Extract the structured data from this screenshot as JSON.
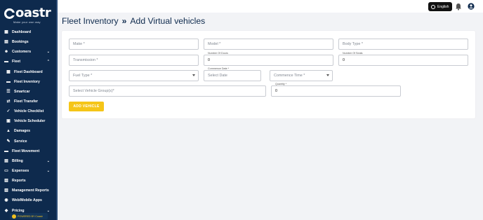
{
  "app": {
    "logo_text": "oastr",
    "logo_tagline": "Make your own way",
    "powered_by": "POWERED BY Coastr"
  },
  "topbar": {
    "language_label": "English",
    "icons": [
      "globe-icon",
      "bell-icon",
      "user-account-icon"
    ]
  },
  "sidebar": {
    "items": [
      {
        "label": "Dashboard",
        "icon": "dashboard-icon",
        "has_chevron": false,
        "sub": false
      },
      {
        "label": "Bookings",
        "icon": "calendar-icon",
        "has_chevron": false,
        "sub": false
      },
      {
        "label": "Customers",
        "icon": "users-icon",
        "has_chevron": true,
        "chevron": "down",
        "sub": false
      },
      {
        "label": "Fleet",
        "icon": "car-icon",
        "has_chevron": true,
        "chevron": "up",
        "sub": false
      },
      {
        "label": "Fleet Dashboard",
        "icon": "grid-icon",
        "has_chevron": false,
        "sub": true
      },
      {
        "label": "Fleet Inventory",
        "icon": "car-icon",
        "has_chevron": false,
        "sub": true
      },
      {
        "label": "Smartcar",
        "icon": "list-icon",
        "has_chevron": false,
        "sub": true
      },
      {
        "label": "Fleet Transfer",
        "icon": "transfer-icon",
        "has_chevron": false,
        "sub": true
      },
      {
        "label": "Vehicle Checklist",
        "icon": "checklist-icon",
        "has_chevron": false,
        "sub": true
      },
      {
        "label": "Vehicle Scheduler",
        "icon": "scheduler-icon",
        "has_chevron": false,
        "sub": true
      },
      {
        "label": "Damages",
        "icon": "warning-icon",
        "has_chevron": false,
        "sub": true
      },
      {
        "label": "Service",
        "icon": "wrench-icon",
        "has_chevron": false,
        "sub": true
      },
      {
        "label": "Fleet Movement",
        "icon": "car-icon",
        "has_chevron": false,
        "sub": false
      },
      {
        "label": "Billing",
        "icon": "billing-icon",
        "has_chevron": true,
        "chevron": "down",
        "sub": false
      },
      {
        "label": "Expenses",
        "icon": "expenses-icon",
        "has_chevron": true,
        "chevron": "down",
        "sub": false
      },
      {
        "label": "Reports",
        "icon": "reports-icon",
        "has_chevron": false,
        "sub": false
      },
      {
        "label": "Management Reports",
        "icon": "reports-icon",
        "has_chevron": false,
        "sub": false
      },
      {
        "label": "Web/Mobile Apps",
        "icon": "globe-icon",
        "has_chevron": false,
        "sub": false
      },
      {
        "label": "Pricing",
        "icon": "tag-icon",
        "has_chevron": true,
        "chevron": "down",
        "sub": false
      }
    ]
  },
  "header": {
    "breadcrumb_parent": "Fleet Inventory",
    "separator": "»",
    "page_title": "Add Virtual vehicles"
  },
  "form": {
    "make": {
      "placeholder": "Make *",
      "value": ""
    },
    "model": {
      "placeholder": "Model *",
      "value": ""
    },
    "body_type": {
      "placeholder": "Body Type *",
      "value": ""
    },
    "transmission": {
      "placeholder": "Transmission *",
      "value": ""
    },
    "number_of_doors": {
      "label": "Number Of Doors",
      "value": "0"
    },
    "number_of_seats": {
      "label": "Number Of Seats",
      "value": "0"
    },
    "fuel_type": {
      "placeholder": "Fuel Type *",
      "value": ""
    },
    "commence_date": {
      "label": "Commence Date *",
      "placeholder": "Select Date",
      "value": ""
    },
    "commence_time": {
      "placeholder": "Commence Time *",
      "value": ""
    },
    "vehicle_groups": {
      "placeholder": "Select Vehicle Group(s)*",
      "value": ""
    },
    "quantity": {
      "label": "Quantity *",
      "value": "0"
    },
    "add_button_label": "ADD VEHICLE"
  },
  "colors": {
    "sidebar_bg": "#0e2a4d",
    "accent": "#f5c518",
    "title": "#0e2a4d"
  }
}
